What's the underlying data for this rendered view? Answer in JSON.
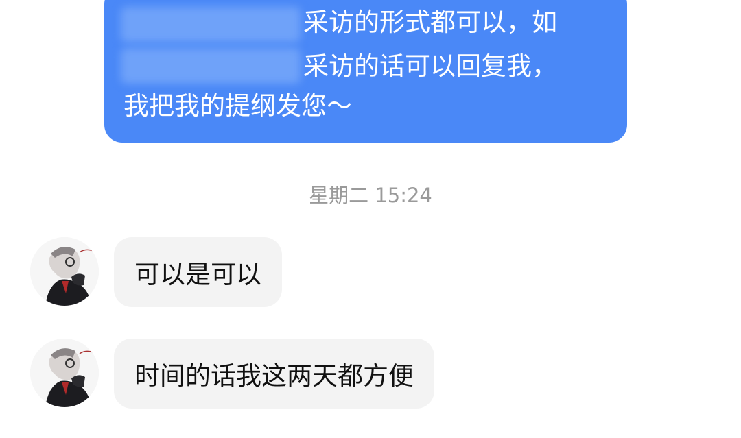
{
  "outgoing_message": {
    "line1": "采访的形式都可以，如",
    "line2": "采访的话可以回复我，",
    "line3": "我把我的提纲发您～"
  },
  "timestamp": "星期二 15:24",
  "incoming_messages": [
    {
      "text": "可以是可以",
      "avatar": "avatar-icon"
    },
    {
      "text": "时间的话我这两天都方便",
      "avatar": "avatar-icon"
    }
  ],
  "colors": {
    "outgoing_bubble": "#4a88f7",
    "incoming_bubble": "#f3f3f3",
    "timestamp_text": "#9a9a9a"
  }
}
